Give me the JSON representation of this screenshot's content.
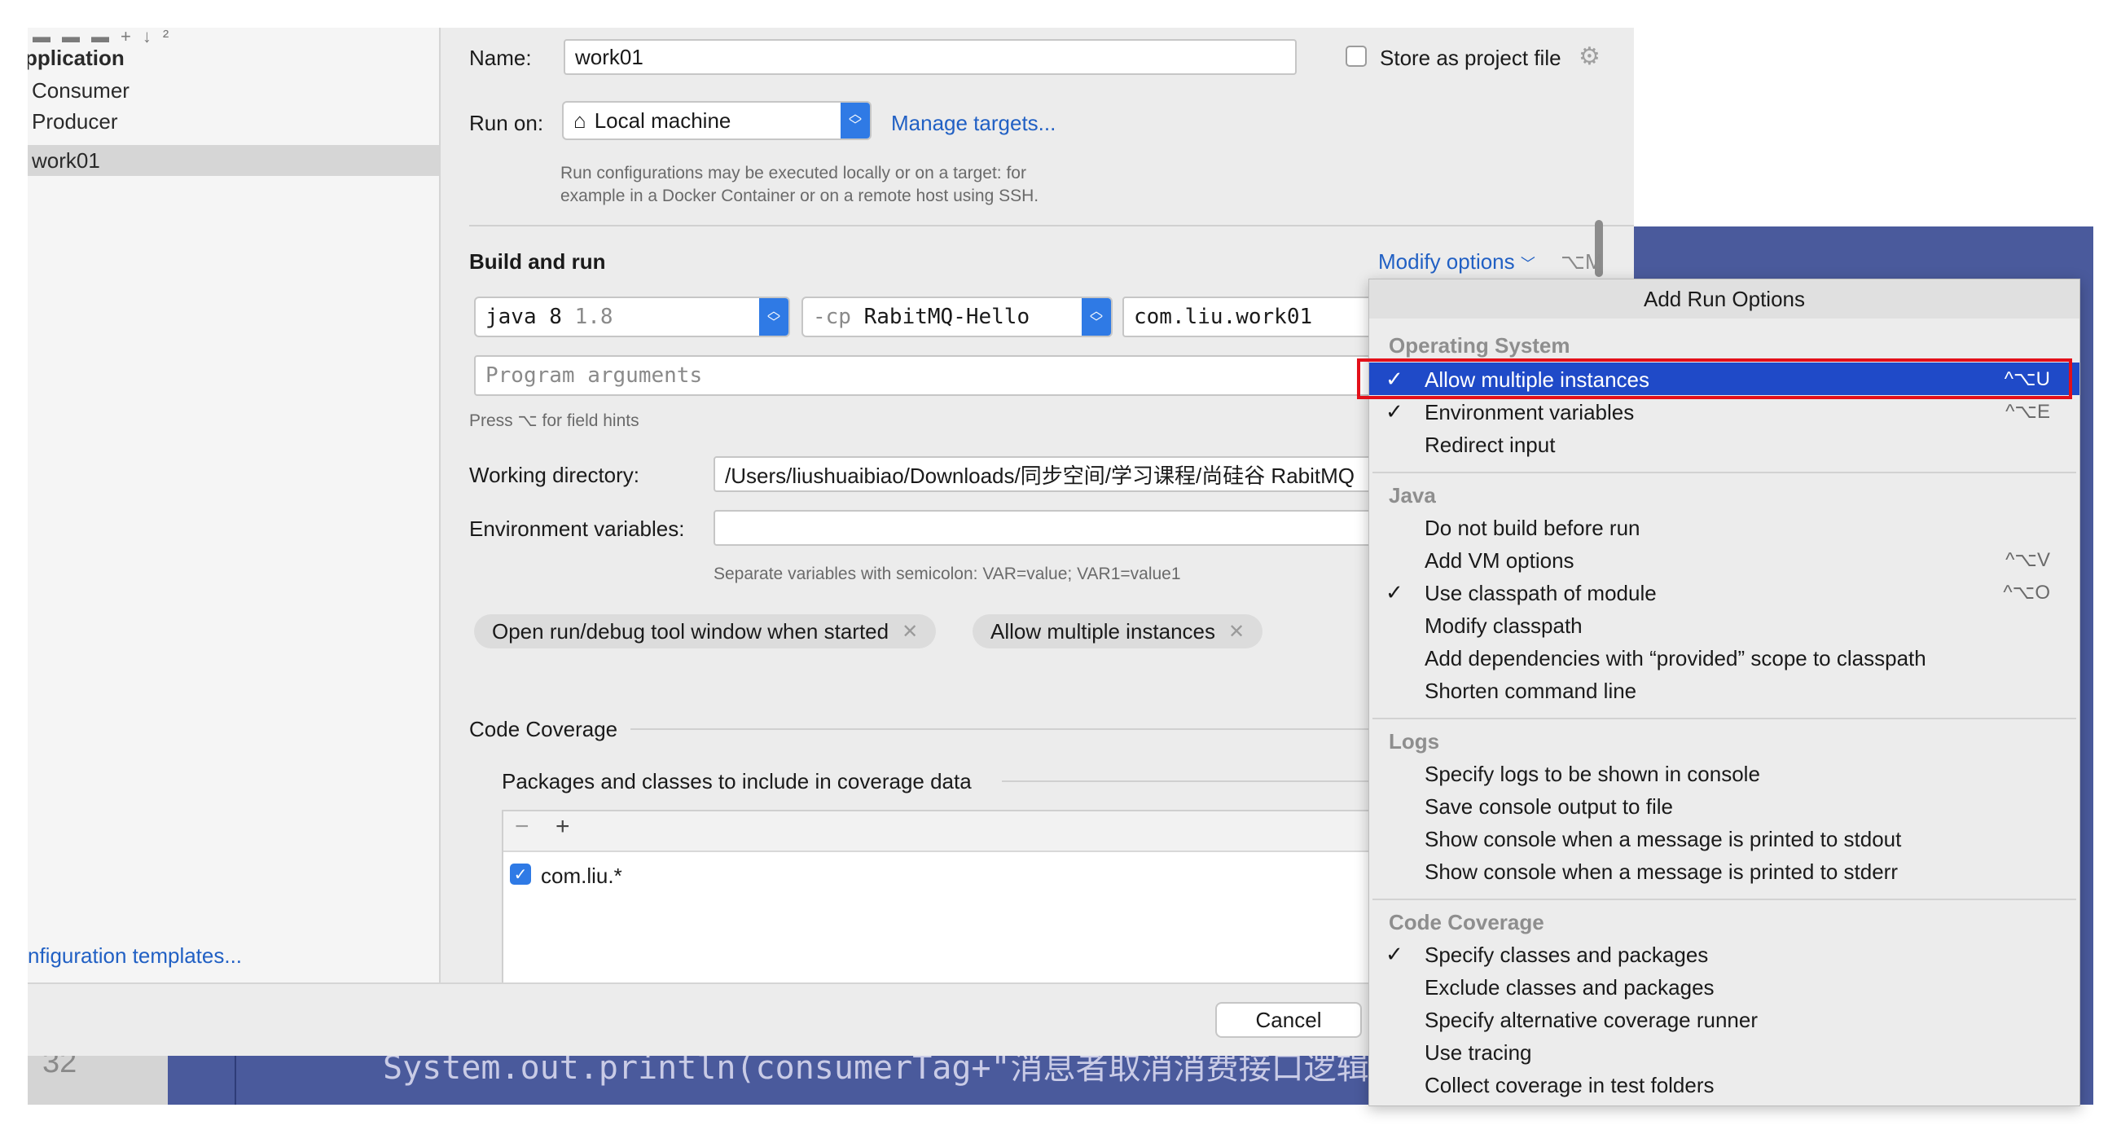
{
  "sidebar": {
    "header_partial": "pplication",
    "items": [
      "Consumer",
      "Producer",
      "work01"
    ],
    "selected": "work01",
    "config_templates_link": "nfiguration templates..."
  },
  "form": {
    "name_label": "Name:",
    "name_value": "work01",
    "store_as_project_file": "Store as project file",
    "run_on_label": "Run on:",
    "run_on_value": "Local machine",
    "manage_targets": "Manage targets...",
    "run_on_hint_line1": "Run configurations may be executed locally or on a target: for",
    "run_on_hint_line2": "example in a Docker Container or on a remote host using SSH.",
    "build_and_run_title": "Build and run",
    "modify_options": "Modify options",
    "modify_options_shortcut": "⌥M",
    "jdk_value": "java 8",
    "jdk_version": "1.8",
    "cp_prefix": "-cp",
    "cp_value": "RabitMQ-Hello",
    "main_class": "com.liu.work01",
    "program_args_placeholder": "Program arguments",
    "field_hints": "Press ⌥ for field hints",
    "working_dir_label": "Working directory:",
    "working_dir_value": "/Users/liushuaibiao/Downloads/同步空间/学习课程/尚硅谷 RabitMQ",
    "env_vars_label": "Environment variables:",
    "env_vars_hint": "Separate variables with semicolon: VAR=value; VAR1=value1",
    "chips": [
      "Open run/debug tool window when started",
      "Allow multiple instances"
    ],
    "code_coverage_title": "Code Coverage",
    "coverage_packages_label": "Packages and classes to include in coverage data",
    "coverage_entry": "com.liu.*",
    "cancel_button": "Cancel"
  },
  "editor": {
    "line_number": "32",
    "code_text": "System.out.println(consumerTag+\"消息者取消消费接口逻辑\");"
  },
  "popup": {
    "title": "Add Run Options",
    "sections": {
      "os": "Operating System",
      "java": "Java",
      "logs": "Logs",
      "coverage": "Code Coverage"
    },
    "items": {
      "allow_multiple": {
        "label": "Allow multiple instances",
        "shortcut": "^⌥U",
        "checked": true
      },
      "env_vars": {
        "label": "Environment variables",
        "shortcut": "^⌥E",
        "checked": true
      },
      "redirect_input": {
        "label": "Redirect input"
      },
      "no_build": {
        "label": "Do not build before run"
      },
      "add_vm": {
        "label": "Add VM options",
        "shortcut": "^⌥V"
      },
      "use_classpath": {
        "label": "Use classpath of module",
        "shortcut": "^⌥O",
        "checked": true
      },
      "modify_classpath": {
        "label": "Modify classpath"
      },
      "add_deps": {
        "label": "Add dependencies with “provided” scope to classpath"
      },
      "shorten_cmd": {
        "label": "Shorten command line"
      },
      "logs_console": {
        "label": "Specify logs to be shown in console"
      },
      "save_output": {
        "label": "Save console output to file"
      },
      "show_stdout": {
        "label": "Show console when a message is printed to stdout"
      },
      "show_stderr": {
        "label": "Show console when a message is printed to stderr"
      },
      "specify_classes": {
        "label": "Specify classes and packages",
        "checked": true
      },
      "exclude_classes": {
        "label": "Exclude classes and packages"
      },
      "alt_runner": {
        "label": "Specify alternative coverage runner"
      },
      "use_tracing": {
        "label": "Use tracing"
      },
      "collect_tests": {
        "label": "Collect coverage in test folders"
      }
    }
  },
  "colors": {
    "selection_blue": "#1f4ac8",
    "highlight_red": "#e3101a",
    "link_blue": "#2160c4",
    "editor_bg": "#4a5a9c"
  }
}
